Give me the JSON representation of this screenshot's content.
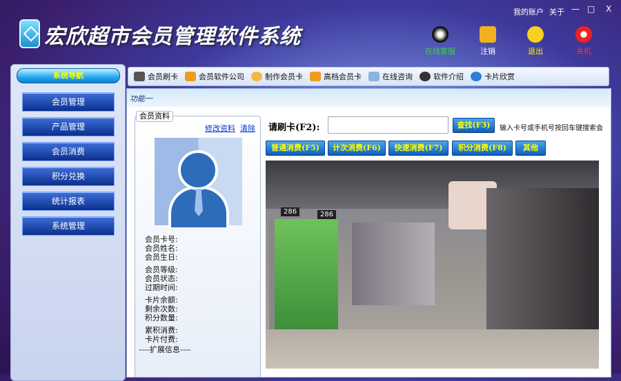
{
  "app": {
    "title": "宏欣超市会员管理软件系统",
    "my_account": "我的账户",
    "about": "关于",
    "minimize": "—",
    "maximize": "□",
    "close": "X"
  },
  "top_buttons": [
    {
      "label": "在线客服",
      "color": "#33dd33"
    },
    {
      "label": "注销",
      "color": "#ffffff"
    },
    {
      "label": "退出",
      "color": "#ffee00"
    },
    {
      "label": "关机",
      "color": "#ff3333"
    }
  ],
  "sidebar": {
    "header": "系统导航",
    "items": [
      "会员管理",
      "产品管理",
      "会员消费",
      "积分兑换",
      "统计报表",
      "系统管理"
    ]
  },
  "toolbar": [
    "会员刷卡",
    "会员软件公司",
    "制作会员卡",
    "高档会员卡",
    "在线咨询",
    "软件介绍",
    "卡片欣赏"
  ],
  "function_title": "功能一",
  "member": {
    "legend": "会员资料",
    "edit_link": "修改资料",
    "clear_link": "清除",
    "fields": [
      "会员卡号:",
      "会员姓名:",
      "会员生日:",
      "会员等级:",
      "会员状态:",
      "过期时间:",
      "卡片余额:",
      "剩余次数:",
      "积分数量:",
      "累积消费:",
      "卡片付费:"
    ],
    "ext_info": "----扩展信息----"
  },
  "card": {
    "label": "请刷卡(F2):",
    "value": "",
    "search_button": "查找(F3)",
    "hint": "输入卡号或手机号按回车键搜索会"
  },
  "consume_buttons": [
    "普通消费(F5)",
    "计次消费(F6)",
    "快速消费(F7)",
    "积分消费(F8)",
    "其他"
  ],
  "store_image": {
    "price_tags": [
      "286",
      "286"
    ]
  }
}
